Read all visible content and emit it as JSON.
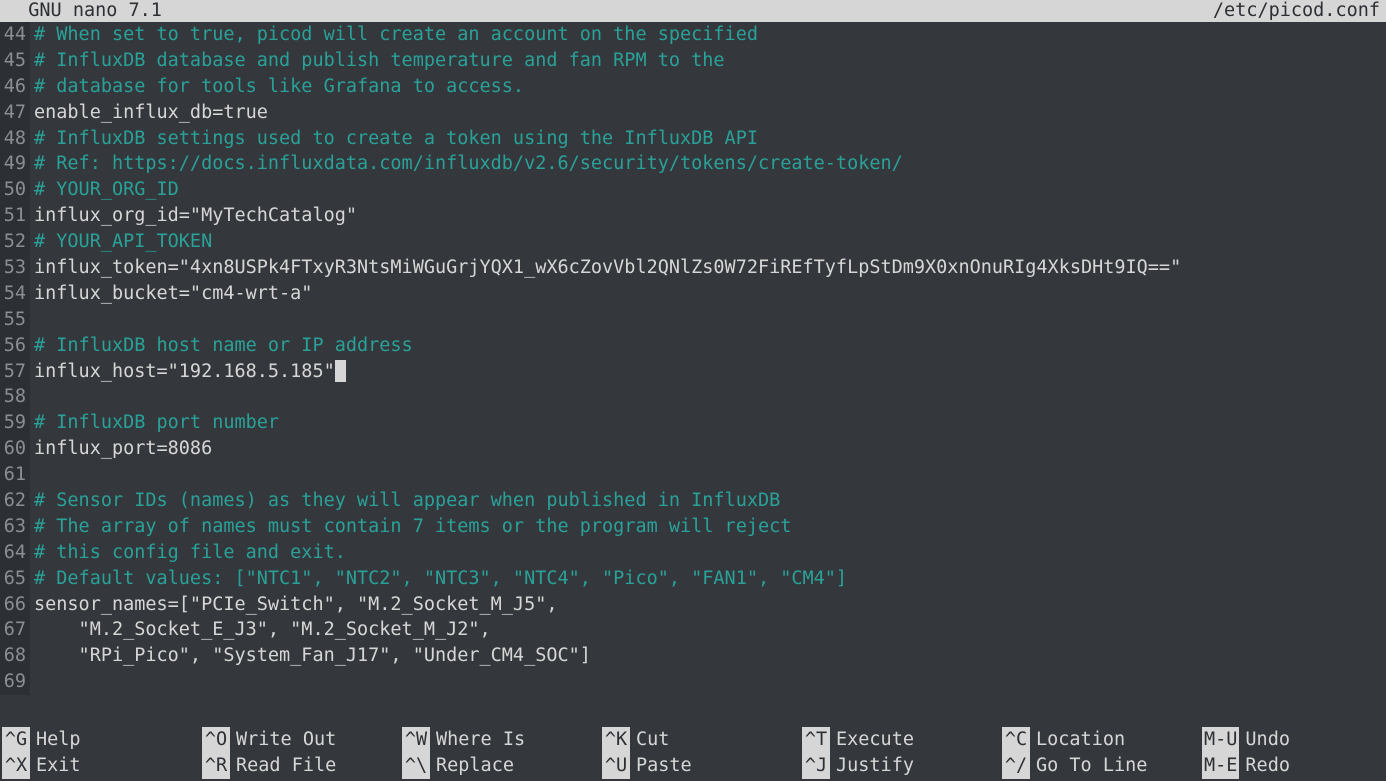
{
  "title": {
    "app": "  GNU nano 7.1",
    "file": "/etc/picod.conf"
  },
  "lines": {
    "l44": {
      "num": "44",
      "t1": "# When set to true, picod will create an account on the specified"
    },
    "l45": {
      "num": "45",
      "t1": "# InfluxDB database and publish temperature and fan RPM to the"
    },
    "l46": {
      "num": "46",
      "t1": "# database for tools like Grafana to access."
    },
    "l47": {
      "num": "47",
      "t1": "enable_influx_db=true"
    },
    "l48": {
      "num": "48",
      "t1": "# InfluxDB settings used to create a token using the InfluxDB API"
    },
    "l49": {
      "num": "49",
      "t1": "# Ref: https://docs.influxdata.com/influxdb/v2.6/security/tokens/create-token/"
    },
    "l50": {
      "num": "50",
      "t1": "# YOUR_ORG_ID"
    },
    "l51": {
      "num": "51",
      "t1": "influx_org_id=\"MyTechCatalog\""
    },
    "l52": {
      "num": "52",
      "t1": "# YOUR_API_TOKEN"
    },
    "l53": {
      "num": "53",
      "t1": "influx_token=\"4xn8USPk4FTxyR3NtsMiWGuGrjYQX1_wX6cZovVbl2QNlZs0W72FiREfTyfLpStDm9X0xnOnuRIg4XksDHt9IQ==\""
    },
    "l54": {
      "num": "54",
      "t1": "influx_bucket=\"cm4-wrt-a\""
    },
    "l55": {
      "num": "55",
      "t1": ""
    },
    "l56": {
      "num": "56",
      "t1": "# InfluxDB host name or IP address"
    },
    "l57": {
      "num": "57",
      "t1": "influx_host=\"192.168.5.185\""
    },
    "l58": {
      "num": "58",
      "t1": ""
    },
    "l59": {
      "num": "59",
      "t1": "# InfluxDB port number"
    },
    "l60": {
      "num": "60",
      "t1": "influx_port=8086"
    },
    "l61": {
      "num": "61",
      "t1": ""
    },
    "l62": {
      "num": "62",
      "t1": "# Sensor IDs (names) as they will appear when published in InfluxDB"
    },
    "l63": {
      "num": "63",
      "t1": "# The array of names must contain 7 items or the program will reject"
    },
    "l64": {
      "num": "64",
      "t1": "# this config file and exit."
    },
    "l65": {
      "num": "65",
      "t1": "# Default values: [\"NTC1\", \"NTC2\", \"NTC3\", \"NTC4\", \"Pico\", \"FAN1\", \"CM4\"]"
    },
    "l66": {
      "num": "66",
      "t1": "sensor_names=[\"PCIe_Switch\", \"M.2_Socket_M_J5\","
    },
    "l67": {
      "num": "67",
      "t1": "    \"M.2_Socket_E_J3\", \"M.2_Socket_M_J2\","
    },
    "l68": {
      "num": "68",
      "t1": "    \"RPi_Pico\", \"System_Fan_J17\", \"Under_CM4_SOC\"]"
    },
    "l69": {
      "num": "69",
      "t1": ""
    }
  },
  "shortcuts": {
    "s1": {
      "key": "^G",
      "label": "Help"
    },
    "s2": {
      "key": "^O",
      "label": "Write Out"
    },
    "s3": {
      "key": "^W",
      "label": "Where Is"
    },
    "s4": {
      "key": "^K",
      "label": "Cut"
    },
    "s5": {
      "key": "^T",
      "label": "Execute"
    },
    "s6": {
      "key": "^C",
      "label": "Location"
    },
    "s7": {
      "key": "M-U",
      "label": "Undo"
    },
    "s8": {
      "key": "^X",
      "label": "Exit"
    },
    "s9": {
      "key": "^R",
      "label": "Read File"
    },
    "s10": {
      "key": "^\\",
      "label": "Replace"
    },
    "s11": {
      "key": "^U",
      "label": "Paste"
    },
    "s12": {
      "key": "^J",
      "label": "Justify"
    },
    "s13": {
      "key": "^/",
      "label": "Go To Line"
    },
    "s14": {
      "key": "M-E",
      "label": "Redo"
    }
  }
}
